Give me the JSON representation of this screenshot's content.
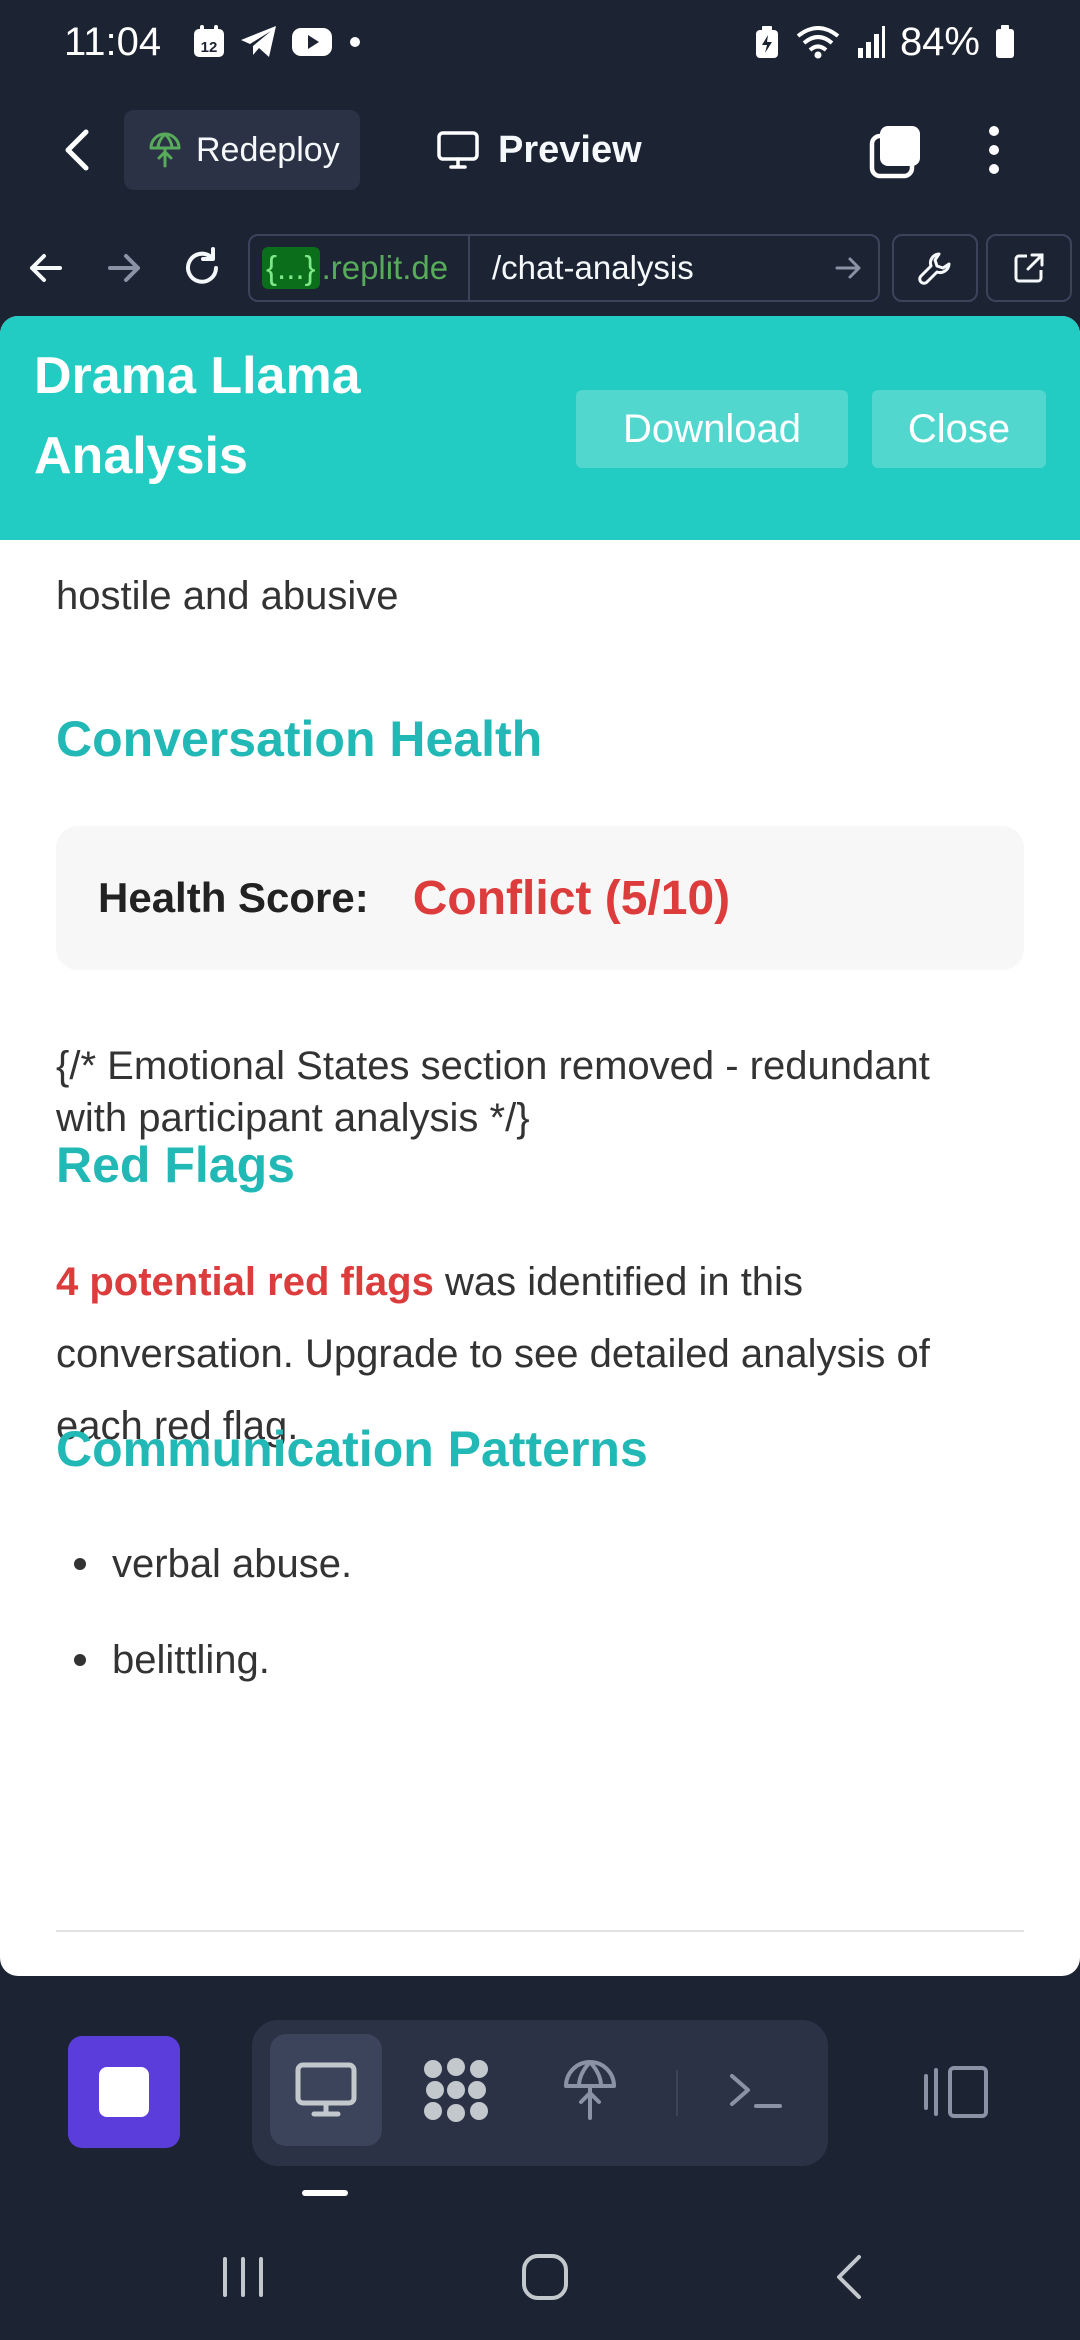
{
  "status_bar": {
    "time": "11:04",
    "calendar_day": "12",
    "battery": "84%"
  },
  "top_bar": {
    "redeploy_label": "Redeploy",
    "preview_label": "Preview"
  },
  "browser": {
    "url_host_tag": "{...}",
    "url_host": ".replit.de",
    "url_path": "/chat-analysis"
  },
  "app": {
    "title_line1": "Drama Llama",
    "title_line2": "Analysis",
    "download_label": "Download",
    "close_label": "Close"
  },
  "content": {
    "intro_text": "hostile and abusive",
    "health_heading": "Conversation Health",
    "health_score_label": "Health Score:",
    "health_score_value": "Conflict (5/10)",
    "comment_text": "{/* Emotional States section removed - redundant with participant analysis */}",
    "red_flags_heading": "Red Flags",
    "red_flags_highlight": "4 potential red flags",
    "red_flags_text": " was identified in this conversation. Upgrade to see detailed analysis of each red flag.",
    "patterns_heading": "Communication Patterns",
    "patterns": [
      "verbal abuse.",
      "belittling."
    ]
  },
  "colors": {
    "accent_teal": "#22ccc2",
    "heading_teal": "#22b8b5",
    "danger_red": "#dc3c3c",
    "replit_bg": "#1c2333",
    "stop_purple": "#5b3ddb"
  },
  "icons": {
    "bottom_tools": [
      "monitor-icon",
      "workspace-grid-icon",
      "deploy-icon",
      "terminal-icon"
    ]
  }
}
